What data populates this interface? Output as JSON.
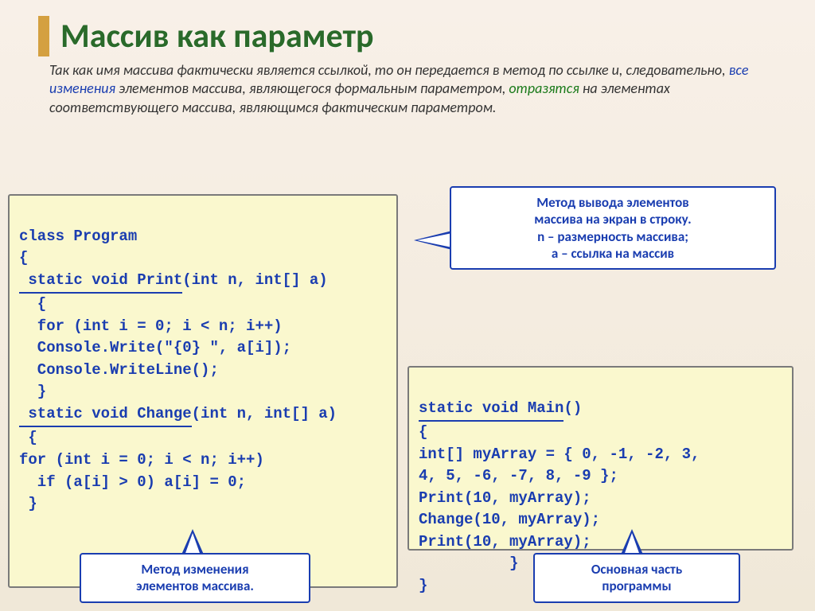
{
  "title": "Массив как параметр",
  "intro": {
    "pre": "Так как имя массива фактически является ссылкой, то он передается в метод по ссылке и, следовательно, ",
    "em1": "все изменения",
    "mid1": " элементов массива, являющегося формальным параметром, ",
    "em2": "отразятся",
    "mid2": " на элементах соответствующего массива, являющимся фактическим параметром.",
    "end": ""
  },
  "code_main": {
    "l1": "class Program",
    "l2": "{",
    "l3a": " static void Print",
    "l3b": "(int n, int[] a)",
    "l4": "  {",
    "l5": "  for (int i = 0; i < n; i++)",
    "l6": "  Console.Write(\"{0} \", a[i]);",
    "l7": "  Console.WriteLine();",
    "l8": "  }",
    "l9a": " static void Change",
    "l9b": "(int n, int[] a)",
    "l10": " {",
    "l11": "for (int i = 0; i < n; i++)",
    "l12": "  if (a[i] > 0) a[i] = 0;",
    "l13": " }"
  },
  "code_right": {
    "l1a": "static void Main",
    "l1b": "()",
    "l2": "{",
    "l3": "int[] myArray = { 0, -1, -2, 3,",
    "l4": "4, 5, -6, -7, 8, -9 };",
    "l5": "Print(10, myArray);",
    "l6": "Change(10, myArray);",
    "l7": "Print(10, myArray);",
    "l8": "          }",
    "l9": "}"
  },
  "callouts": {
    "c1": {
      "l1": "Метод вывода элементов",
      "l2": "массива  на экран в строку.",
      "l3": "n – размерность массива;",
      "l4": "a – ссылка на массив"
    },
    "c2": {
      "l1": "Метод изменения",
      "l2": "элементов массива."
    },
    "c3": {
      "l1": "Основная часть",
      "l2": "программы"
    }
  }
}
